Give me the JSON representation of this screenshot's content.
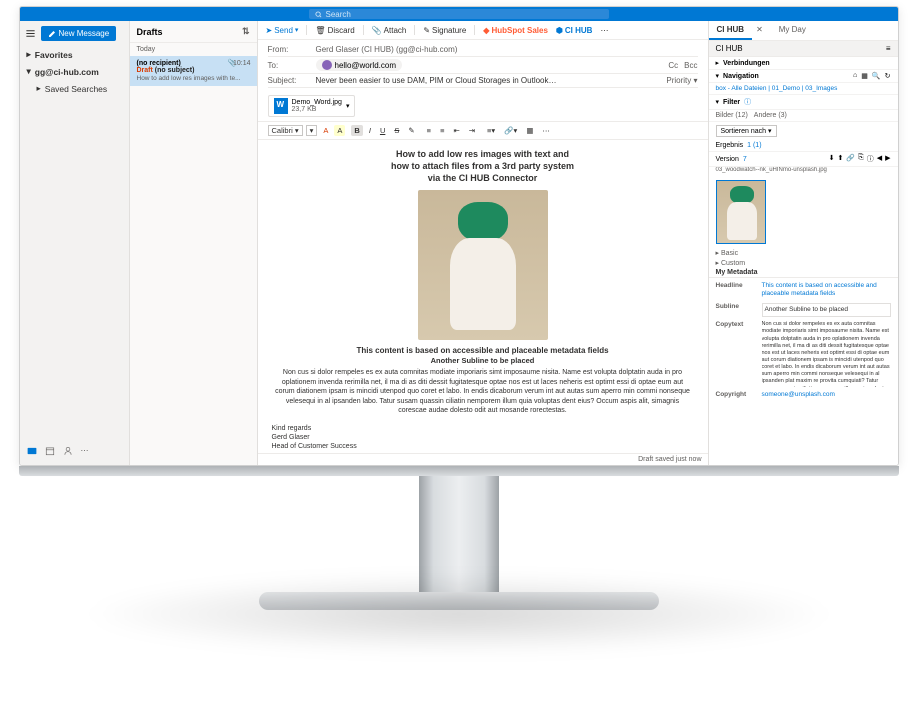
{
  "search_placeholder": "Search",
  "nav": {
    "new": "New Message",
    "favorites": "Favorites",
    "account": "gg@ci-hub.com",
    "saved": "Saved Searches"
  },
  "drafts": {
    "title": "Drafts",
    "today": "Today",
    "item": {
      "tag": "Draft",
      "subject": "(no subject)",
      "time": "10:14",
      "recipient": "(no recipient)",
      "preview": "How to add low res images with te..."
    }
  },
  "cbar": {
    "send": "Send",
    "discard": "Discard",
    "attach": "Attach",
    "signature": "Signature",
    "hubspot": "HubSpot Sales",
    "cihub": "CI HUB"
  },
  "fields": {
    "from": "From:",
    "from_val": "Gerd Glaser (CI HUB) (gg@ci-hub.com)",
    "to": "To:",
    "to_val": "hello@world.com",
    "subject": "Subject:",
    "subject_val": "Never been easier to use DAM, PIM or Cloud Storages in Outlook…",
    "cc": "Cc",
    "bcc": "Bcc",
    "priority": "Priority"
  },
  "attachment": {
    "name": "Demo_Word.jpg",
    "size": "23,7 KB"
  },
  "toolbar": {
    "font": "Calibri"
  },
  "body": {
    "h1": "How to add low res images with text and",
    "h2": "how to attach files from a 3rd party system",
    "h3": "via the CI HUB Connector",
    "caption": "This content is based on accessible and placeable metadata fields",
    "sub": "Another Subline to be placed",
    "para": "Non cus si dolor rempeles es ex auta comnitas modiate imporiaris simt imposaume nisita. Name est volupta dolptatin auda in pro oplationem invenda rerimilla net, il ma di as diti dessit fugitatesque optae nos est ut laces neheris est optimt essi di optae eum aut corum diationem ipsam is mincidi utenpod quo coret et labo. In endis dicaborum verum int aut autas sum aperro min commi nonseque velesequi in al ipsanden labo. Tatur susam quassin ciliatin nemporem illum quia voluptas dent eius? Occum aspis alit, simagnis corescae audae dolesto odit aut mosande rorectestas.",
    "sig1": "Kind regards",
    "sig2": "Gerd Glaser",
    "sig3": "Head of Customer Success"
  },
  "status": "Draft saved just now",
  "panel": {
    "tab_cihub": "CI HUB",
    "tab_myday": "My Day",
    "hdr": "CI HUB",
    "conn": "Verbindungen",
    "nav": "Navigation",
    "crumbs": "box - Alle Dateien | 01_Demo | 03_Images",
    "filter_label": "Filter",
    "filter1": "Bilder (12)",
    "filter2": "Andere (3)",
    "sort": "Sortieren nach",
    "result": "Ergebnis",
    "result_info": "1 (1)",
    "version_label": "Version",
    "version_val": "7",
    "filename": "03_woodwatch--nk_uHINmo-unsplash.jpg",
    "basic": "Basic",
    "custom": "Custom",
    "mymeta": "My Metadata",
    "m_headline_l": "Headline",
    "m_headline_v": "This content is based on accessible and placeable metadata fields",
    "m_subline_l": "Subline",
    "m_subline_v": "Another Subline to be placed",
    "m_copytext_l": "Copytext",
    "m_copytext_v": "Non cus si dolor rempeles es ex auta comnitas modiate imporiaris simt imposaume nisita. Name est volupta dolptatin auda in pro oplationem invenda rerimilla net, il ma di as diti dessit fugitatesque optae nos est ut laces neheris est optimt essi di optae eum aut corum diationem ipsam is mincidi utenpod quo coret et labo. In endis dicaborum verum int aut autas sum aperro min commi nonseque velesequi in al ipsanden plat maxim re provita cumquiati? Tatur susam quassin ciliatin nemporem illum quia voluptas dent eius? Occum aspis alit, simagnis corescae audae dolesto odit aut mosande rorectestas.",
    "m_copyright_l": "Copyright",
    "m_copyright_v": "someone@unsplash.com"
  }
}
